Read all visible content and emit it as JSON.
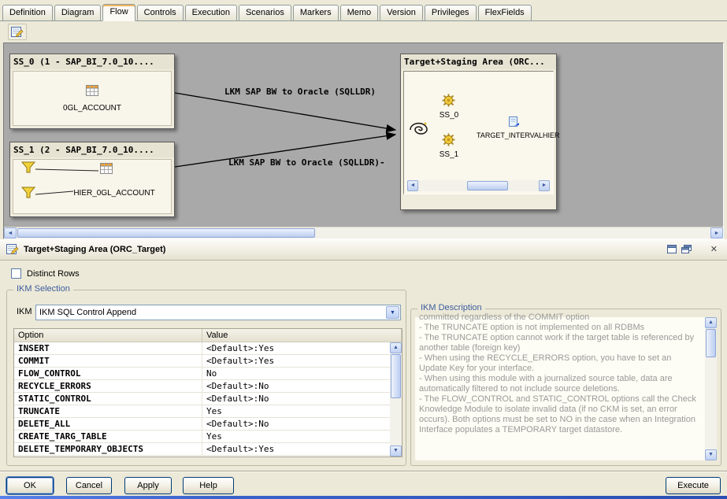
{
  "icons": {
    "up_arrow": "▲",
    "down_arrow": "▼",
    "left_arrow": "◄",
    "right_arrow": "►",
    "close": "✕"
  },
  "tabs": {
    "items": [
      "Definition",
      "Diagram",
      "Flow",
      "Controls",
      "Execution",
      "Scenarios",
      "Markers",
      "Memo",
      "Version",
      "Privileges",
      "FlexFields"
    ],
    "active": "Flow"
  },
  "diagram": {
    "source1": {
      "title": "SS_0 (1 - SAP_BI_7.0_10....",
      "datastore": "0GL_ACCOUNT"
    },
    "source2": {
      "title": "SS_1 (2 - SAP_BI_7.0_10....",
      "datastore": "HIER_0GL_ACCOUNT"
    },
    "target": {
      "title": "Target+Staging Area (ORC...",
      "source_icons": [
        "SS_0",
        "SS_1"
      ],
      "target_datastore": "TARGET_INTERVALHIER"
    },
    "lkm_label_top": "LKM SAP BW to Oracle (SQLLDR)",
    "lkm_label_bottom": "LKM SAP BW to Oracle (SQLLDR)-"
  },
  "panel": {
    "title": "Target+Staging Area (ORC_Target)",
    "distinct_rows": "Distinct Rows",
    "ikm_selection": {
      "legend": "IKM Selection",
      "ikm_label": "IKM",
      "ikm_value": "IKM SQL Control Append",
      "columns": [
        "Option",
        "Value"
      ],
      "options": [
        {
          "option": "INSERT",
          "value": "<Default>:Yes"
        },
        {
          "option": "COMMIT",
          "value": "<Default>:Yes"
        },
        {
          "option": "FLOW_CONTROL",
          "value": "No"
        },
        {
          "option": "RECYCLE_ERRORS",
          "value": "<Default>:No"
        },
        {
          "option": "STATIC_CONTROL",
          "value": "<Default>:No"
        },
        {
          "option": "TRUNCATE",
          "value": "Yes"
        },
        {
          "option": "DELETE_ALL",
          "value": "<Default>:No"
        },
        {
          "option": "CREATE_TARG_TABLE",
          "value": "Yes"
        },
        {
          "option": "DELETE_TEMPORARY_OBJECTS",
          "value": "<Default>:Yes"
        }
      ]
    },
    "ikm_description": {
      "legend": "IKM Description",
      "lines": [
        "committed regardless of the COMMIT option",
        "- The TRUNCATE option is not implemented on all RDBMs",
        "- The TRUNCATE option cannot work if the target table is referenced by another table (foreign key)",
        "- When using the RECYCLE_ERRORS option, you have to set an Update Key for your interface.",
        "- When using this module with a journalized source table, data are automatically filtered to not include source deletions.",
        "- The FLOW_CONTROL and STATIC_CONTROL options call the Check Knowledge Module to isolate invalid data (if no CKM is set, an error occurs). Both options must be set to NO in the case when an Integration Interface populates a TEMPORARY target datastore."
      ]
    }
  },
  "buttons": {
    "ok": "OK",
    "cancel": "Cancel",
    "apply": "Apply",
    "help": "Help",
    "execute": "Execute"
  }
}
